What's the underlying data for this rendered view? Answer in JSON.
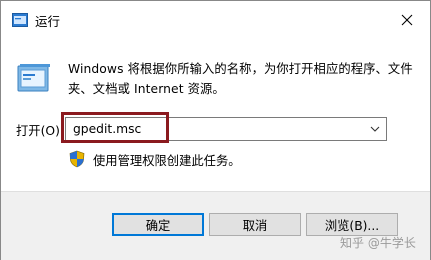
{
  "window": {
    "title": "运行",
    "close_icon": "close-icon"
  },
  "dialog": {
    "description": "Windows 将根据你所输入的名称，为你打开相应的程序、文件夹、文档或 Internet 资源。",
    "open_label": "打开(O):",
    "input_value": "gpedit.msc",
    "admin_note": "使用管理权限创建此任务。"
  },
  "buttons": {
    "ok": "确定",
    "cancel": "取消",
    "browse": "浏览(B)..."
  },
  "watermark": "知乎 @牛学长",
  "colors": {
    "highlight_border": "#8b1a1f",
    "primary_button_border": "#0078d7",
    "footer_bg": "#f0f0f0"
  }
}
